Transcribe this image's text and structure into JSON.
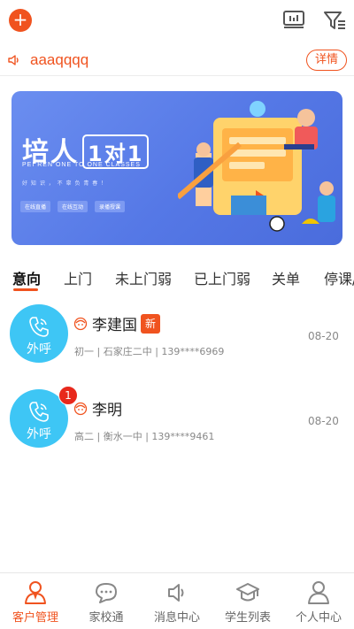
{
  "header": {
    "add_symbol": "+",
    "board_icon": "bulletin-board-icon",
    "filter_icon": "filter-icon"
  },
  "notice": {
    "icon": "speaker-icon",
    "text": "aaaqqqq",
    "detail_label": "详情"
  },
  "banner": {
    "title_main": "培人",
    "title_box": "1对1",
    "subtitle": "PEI REN ONE TO ONE CLASSES",
    "slogan": "好 知 识 ， 不 辜 负 青 春 ！",
    "tags": [
      "在线直播",
      "在线互动",
      "录播授课"
    ]
  },
  "tabs": [
    "意向",
    "上门",
    "未上门弱",
    "已上门弱",
    "关单",
    "停课/"
  ],
  "active_tab": "意向",
  "customers": [
    {
      "name": "李建国",
      "tag": "新",
      "info": "初一 | 石家庄二中 | 139****6969",
      "date": "08-20",
      "call_label": "外呼",
      "badge": ""
    },
    {
      "name": "李明",
      "tag": "",
      "info": "高二 | 衡水一中 | 139****9461",
      "date": "08-20",
      "call_label": "外呼",
      "badge": "1"
    }
  ],
  "bottom_nav": [
    {
      "label": "客户管理",
      "icon": "person-icon",
      "active": true
    },
    {
      "label": "家校通",
      "icon": "chat-bubble-icon",
      "active": false
    },
    {
      "label": "消息中心",
      "icon": "speaker-icon",
      "active": false
    },
    {
      "label": "学生列表",
      "icon": "graduation-cap-icon",
      "active": false
    },
    {
      "label": "个人中心",
      "icon": "user-icon",
      "active": false
    }
  ],
  "colors": {
    "accent": "#f0531f",
    "call": "#3ec6f5",
    "badge": "#e8281c",
    "banner": "#5578e6"
  }
}
